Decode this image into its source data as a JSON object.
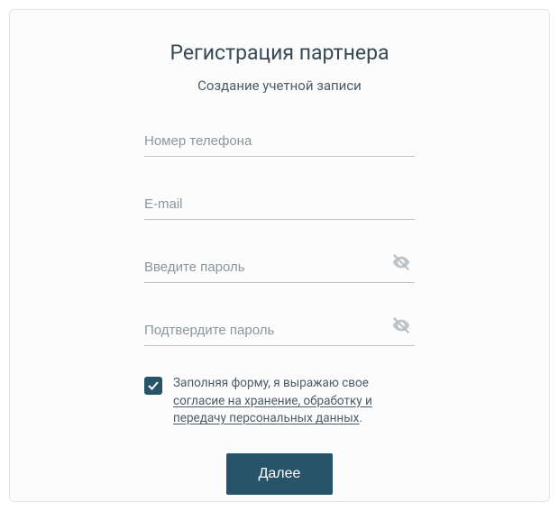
{
  "header": {
    "title": "Регистрация партнера",
    "subtitle": "Создание учетной записи"
  },
  "fields": {
    "phone": {
      "placeholder": "Номер телефона",
      "value": ""
    },
    "email": {
      "placeholder": "E-mail",
      "value": ""
    },
    "password": {
      "placeholder": "Введите пароль",
      "value": ""
    },
    "password_confirm": {
      "placeholder": "Подтвердите пароль",
      "value": ""
    }
  },
  "consent": {
    "checked": true,
    "text_prefix": "Заполняя форму, я выражаю свое ",
    "link_text": "согласие на хранение, обработку и передачу персональных данных",
    "text_suffix": "."
  },
  "actions": {
    "next": "Далее"
  },
  "colors": {
    "accent": "#28546a"
  }
}
